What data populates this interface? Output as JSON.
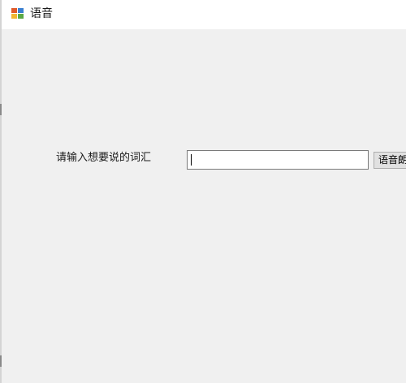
{
  "window": {
    "title": "语音",
    "icon": "app-window-icon"
  },
  "form": {
    "prompt_label": "请输入想要说的词汇",
    "word_input_value": "",
    "speak_button_label": "语音朗读"
  },
  "colors": {
    "client_background": "#f0f0f0",
    "titlebar_background": "#ffffff",
    "button_background": "#e1e1e1",
    "input_border": "#7a7a7a"
  }
}
